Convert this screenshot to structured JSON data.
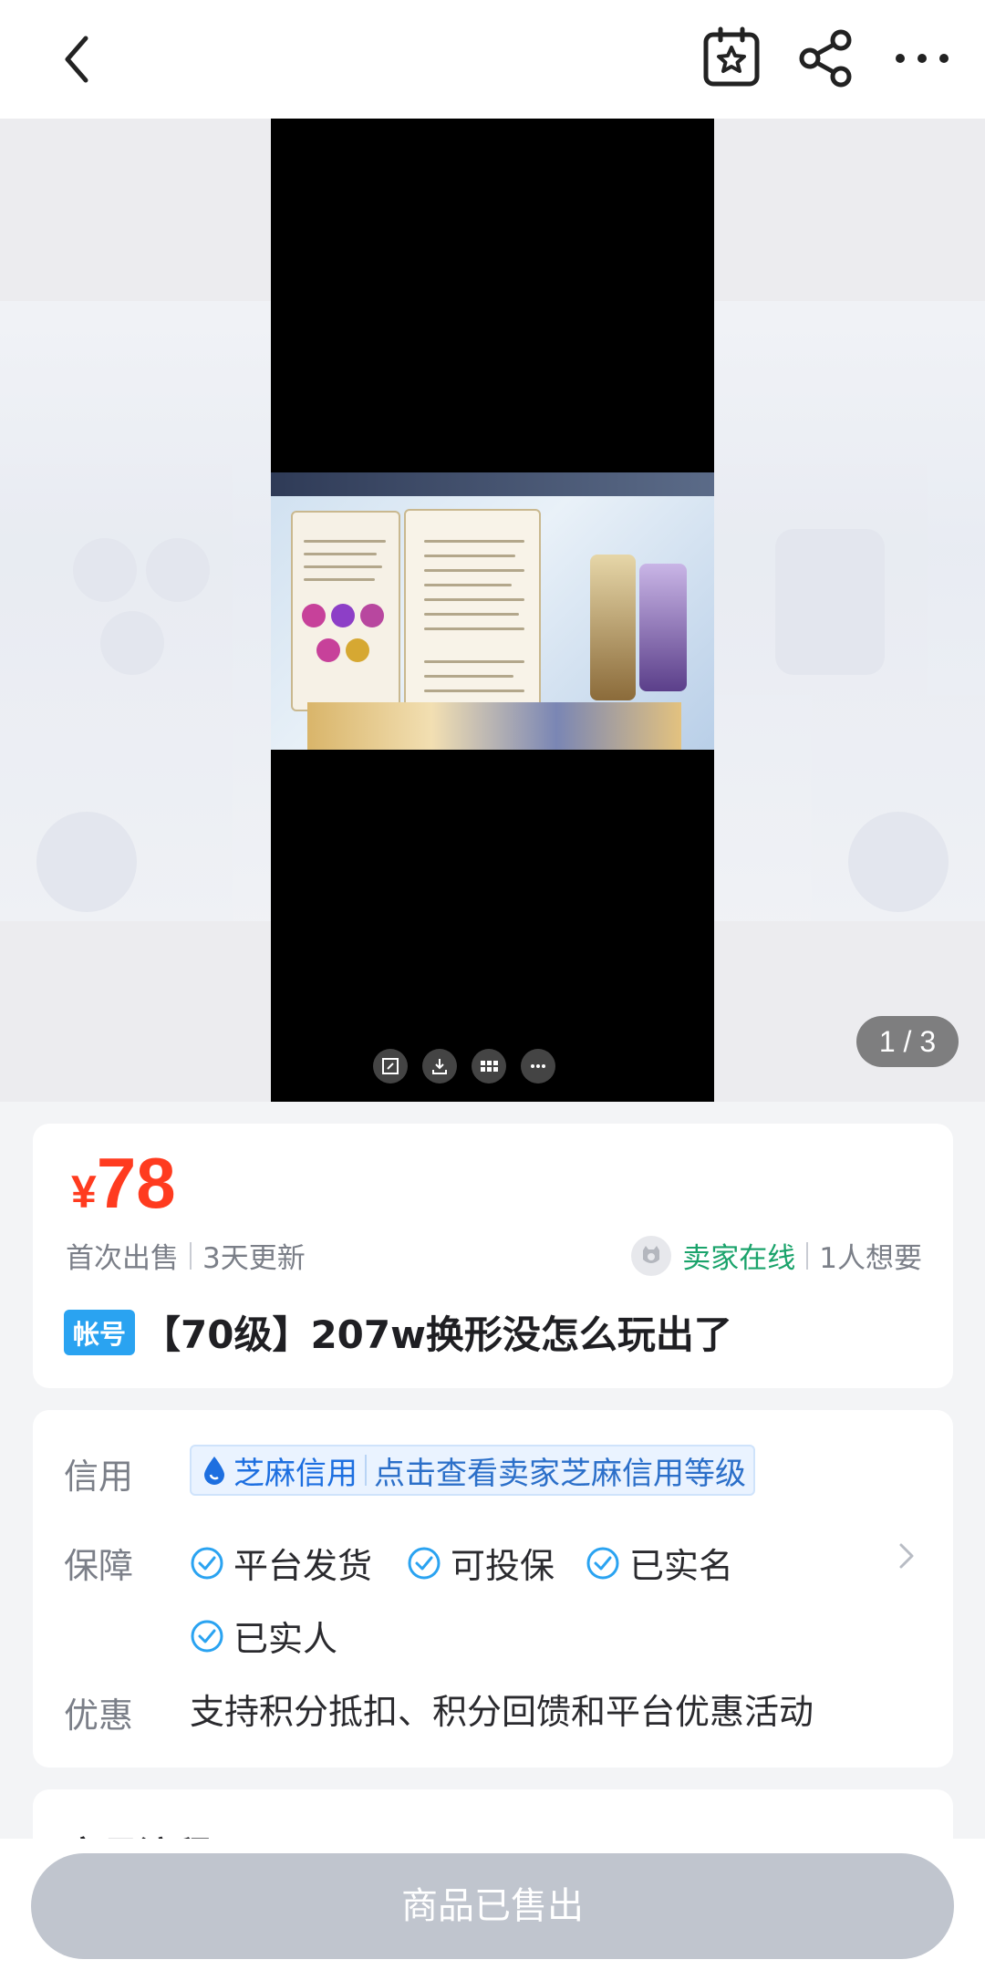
{
  "header": {
    "back_icon": "chevron-left-icon",
    "favorite_icon": "star-bookmark-icon",
    "share_icon": "share-icon",
    "more_icon": "more-dots-icon"
  },
  "media": {
    "counter": "1 / 3",
    "video_controls": [
      "fullscreen-icon",
      "download-icon",
      "grid-icon",
      "more-icon"
    ]
  },
  "listing": {
    "currency": "¥",
    "price": "78",
    "first_sale": "首次出售",
    "updated": "3天更新",
    "seller_online": "卖家在线",
    "wants": "1人想要",
    "tag": "帐号",
    "title": "【70级】207w换形没怎么玩出了"
  },
  "details": {
    "credit_label": "信用",
    "sesame_label": "芝麻信用",
    "sesame_link": "点击查看卖家芝麻信用等级",
    "guarantee_label": "保障",
    "guarantees": [
      "平台发货",
      "可投保",
      "已实名",
      "已实人"
    ],
    "discount_label": "优惠",
    "discount_text": "支持积分抵扣、积分回馈和平台优惠活动"
  },
  "process": {
    "heading": "交易流程"
  },
  "footer": {
    "sold_label": "商品已售出"
  },
  "colors": {
    "price": "#ff3b1f",
    "online": "#1aa36b",
    "tag": "#2aa3f1",
    "sesame": "#1d6fe0",
    "sold_button": "#c0c5ce"
  }
}
